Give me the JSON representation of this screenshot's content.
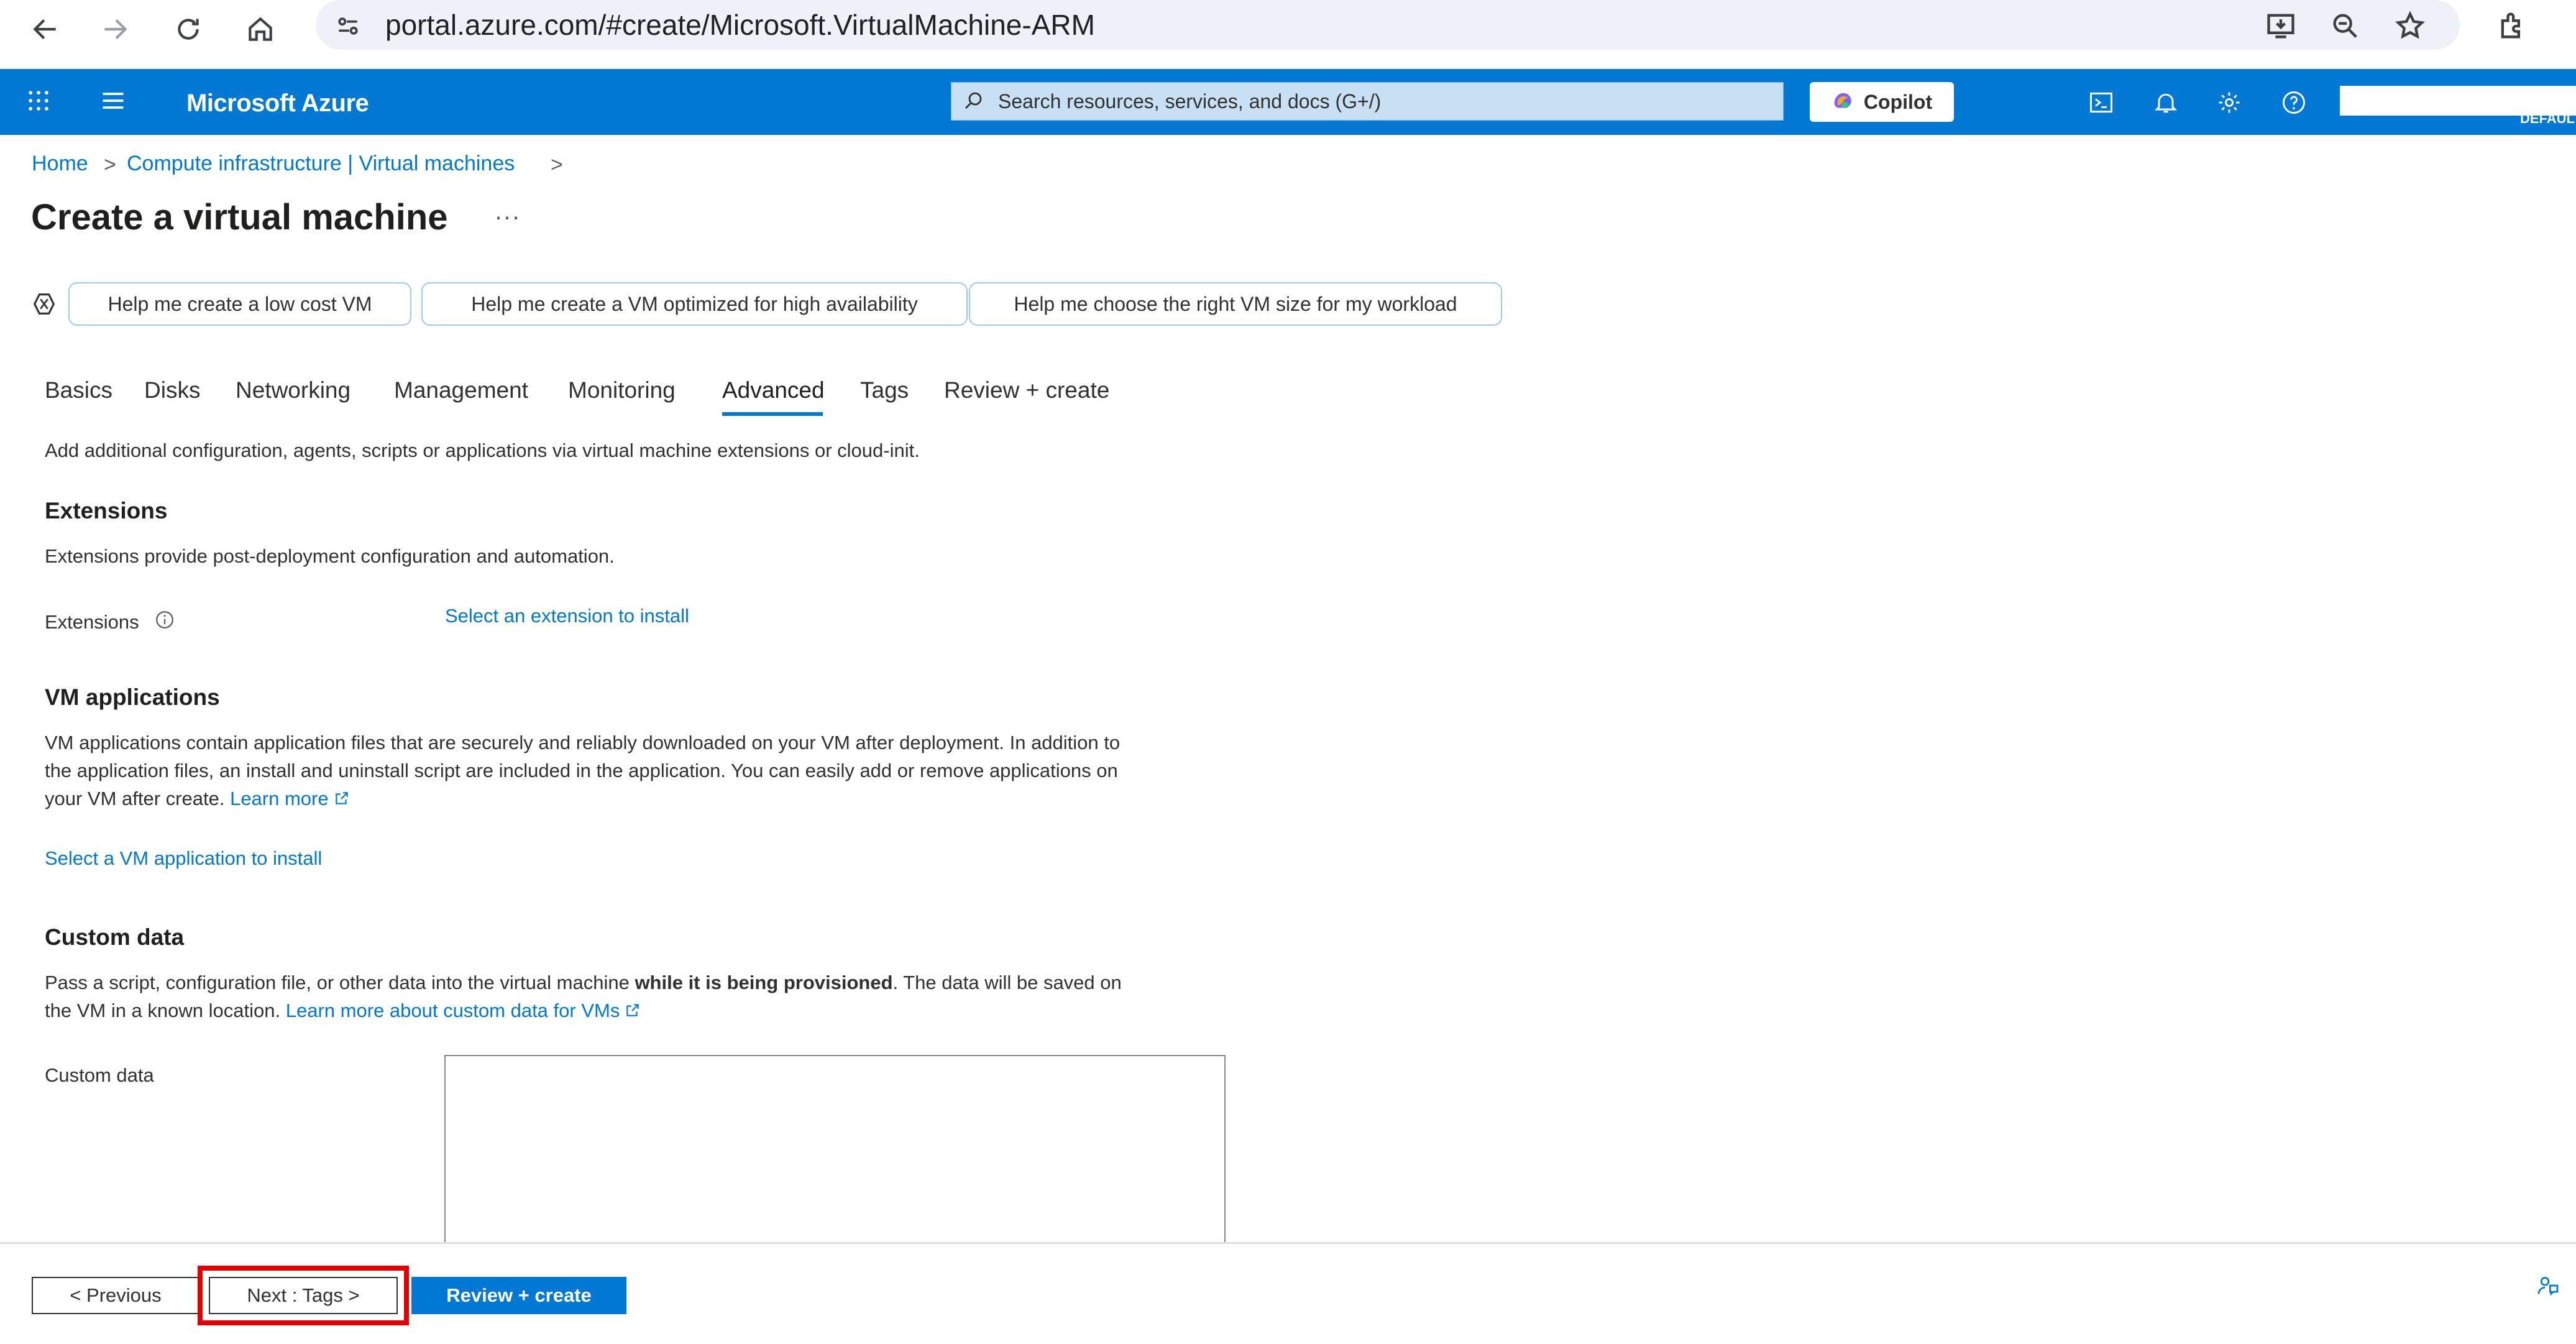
{
  "browser": {
    "url": "portal.azure.com/#create/Microsoft.VirtualMachine-ARM",
    "icons": [
      "back-icon",
      "forward-icon",
      "reload-icon",
      "home-icon",
      "site-info-icon",
      "install-app-icon",
      "zoom-icon",
      "bookmark-star-icon",
      "extensions-icon"
    ]
  },
  "header": {
    "brand": "Microsoft Azure",
    "search_placeholder": "Search resources, services, and docs (G+/)",
    "copilot_label": "Copilot",
    "account_directory": "DEFAULT",
    "colors": {
      "bar": "#0078d4",
      "search": "#c7e0f4"
    }
  },
  "breadcrumb": {
    "items": [
      "Home",
      "Compute infrastructure | Virtual machines"
    ],
    "separator": ">"
  },
  "page": {
    "title": "Create a virtual machine",
    "more_label": "···"
  },
  "chips": [
    "Help me create a low cost VM",
    "Help me create a VM optimized for high availability",
    "Help me choose the right VM size for my workload"
  ],
  "tabs": {
    "items": [
      "Basics",
      "Disks",
      "Networking",
      "Management",
      "Monitoring",
      "Advanced",
      "Tags",
      "Review + create"
    ],
    "active": "Advanced"
  },
  "advanced": {
    "intro": "Add additional configuration, agents, scripts or applications via virtual machine extensions or cloud-init.",
    "extensions": {
      "heading": "Extensions",
      "description": "Extensions provide post-deployment configuration and automation.",
      "field_label": "Extensions",
      "link": "Select an extension to install"
    },
    "vm_applications": {
      "heading": "VM applications",
      "line1": "VM applications contain application files that are securely and reliably downloaded on your VM after deployment. In addition to",
      "line2": "the application files, an install and uninstall script are included in the application. You can easily add or remove applications on",
      "line3": "your VM after create.",
      "learn_more": "Learn more",
      "link": "Select a VM application to install"
    },
    "custom_data": {
      "heading": "Custom data",
      "line1_a": "Pass a script, configuration file, or other data into the virtual machine ",
      "line1_bold": "while it is being provisioned",
      "line1_b": ". The data will be saved on",
      "line2": "the VM in a known location.",
      "learn_more": "Learn more about custom data for VMs",
      "field_label": "Custom data",
      "value": ""
    }
  },
  "footer": {
    "previous": "< Previous",
    "next": "Next : Tags >",
    "review": "Review + create",
    "highlight_color": "#e30000"
  }
}
